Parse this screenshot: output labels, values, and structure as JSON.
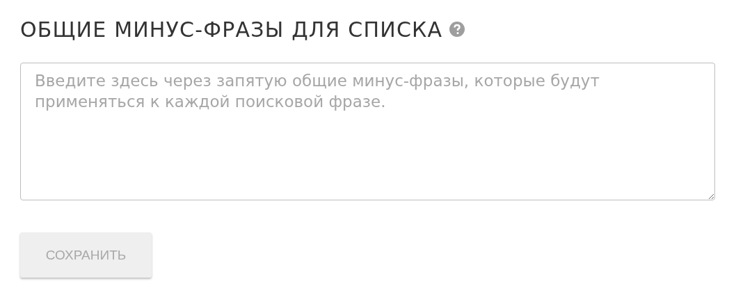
{
  "heading": {
    "title": "ОБЩИЕ МИНУС-ФРАЗЫ ДЛЯ СПИСКА"
  },
  "phrases_field": {
    "placeholder": "Введите здесь через запятую общие минус-фразы, которые будут применяться к каждой поисковой фразе."
  },
  "save_button": {
    "label": "СОХРАНИТЬ",
    "disabled": true
  }
}
